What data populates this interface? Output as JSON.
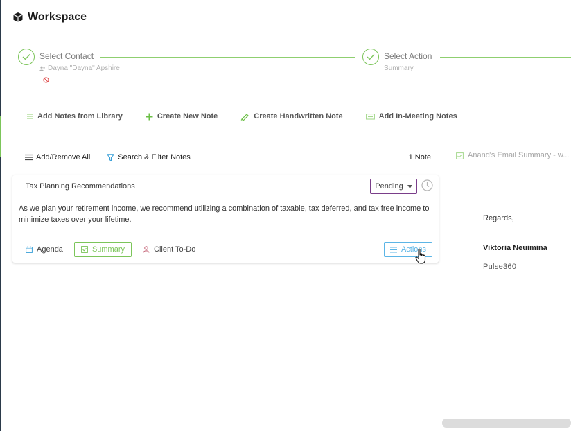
{
  "header": {
    "title": "Workspace",
    "icon": "cube-icon"
  },
  "steps": [
    {
      "title": "Select Contact",
      "subtitle": "Dayna \"Dayna\" Apshire",
      "subtitle_icon": "person-icon",
      "status_icon": "ban-icon"
    },
    {
      "title": "Select Action",
      "subtitle": "Summary"
    }
  ],
  "note_actions": [
    {
      "label": "Add Notes from Library",
      "icon": "library-icon"
    },
    {
      "label": "Create New Note",
      "icon": "plus-icon"
    },
    {
      "label": "Create Handwritten Note",
      "icon": "pen-icon"
    },
    {
      "label": "Add In-Meeting Notes",
      "icon": "meeting-icon"
    }
  ],
  "list_toolbar": {
    "add_remove_label": "Add/Remove All",
    "search_filter_label": "Search & Filter Notes",
    "note_count": "1 Note"
  },
  "note_card": {
    "title": "Tax Planning Recommendations",
    "status": "Pending",
    "body": "As we plan your retirement income, we recommend utilizing a combination of taxable, tax deferred, and tax free income to minimize taxes over your lifetime.",
    "footer": {
      "agenda_label": "Agenda",
      "summary_label": "Summary",
      "client_todo_label": "Client To-Do",
      "actions_label": "Actions"
    }
  },
  "preview": {
    "tab_label": "Anand's Email Summary - w...",
    "regards": "Regards,",
    "signer": "Viktoria Neuimina",
    "company": "Pulse360"
  },
  "colors": {
    "accent_green": "#7cc55a",
    "status_border": "#7a3e8a",
    "actions_blue": "#5cb5e6",
    "rail": "#2b3a4a"
  }
}
